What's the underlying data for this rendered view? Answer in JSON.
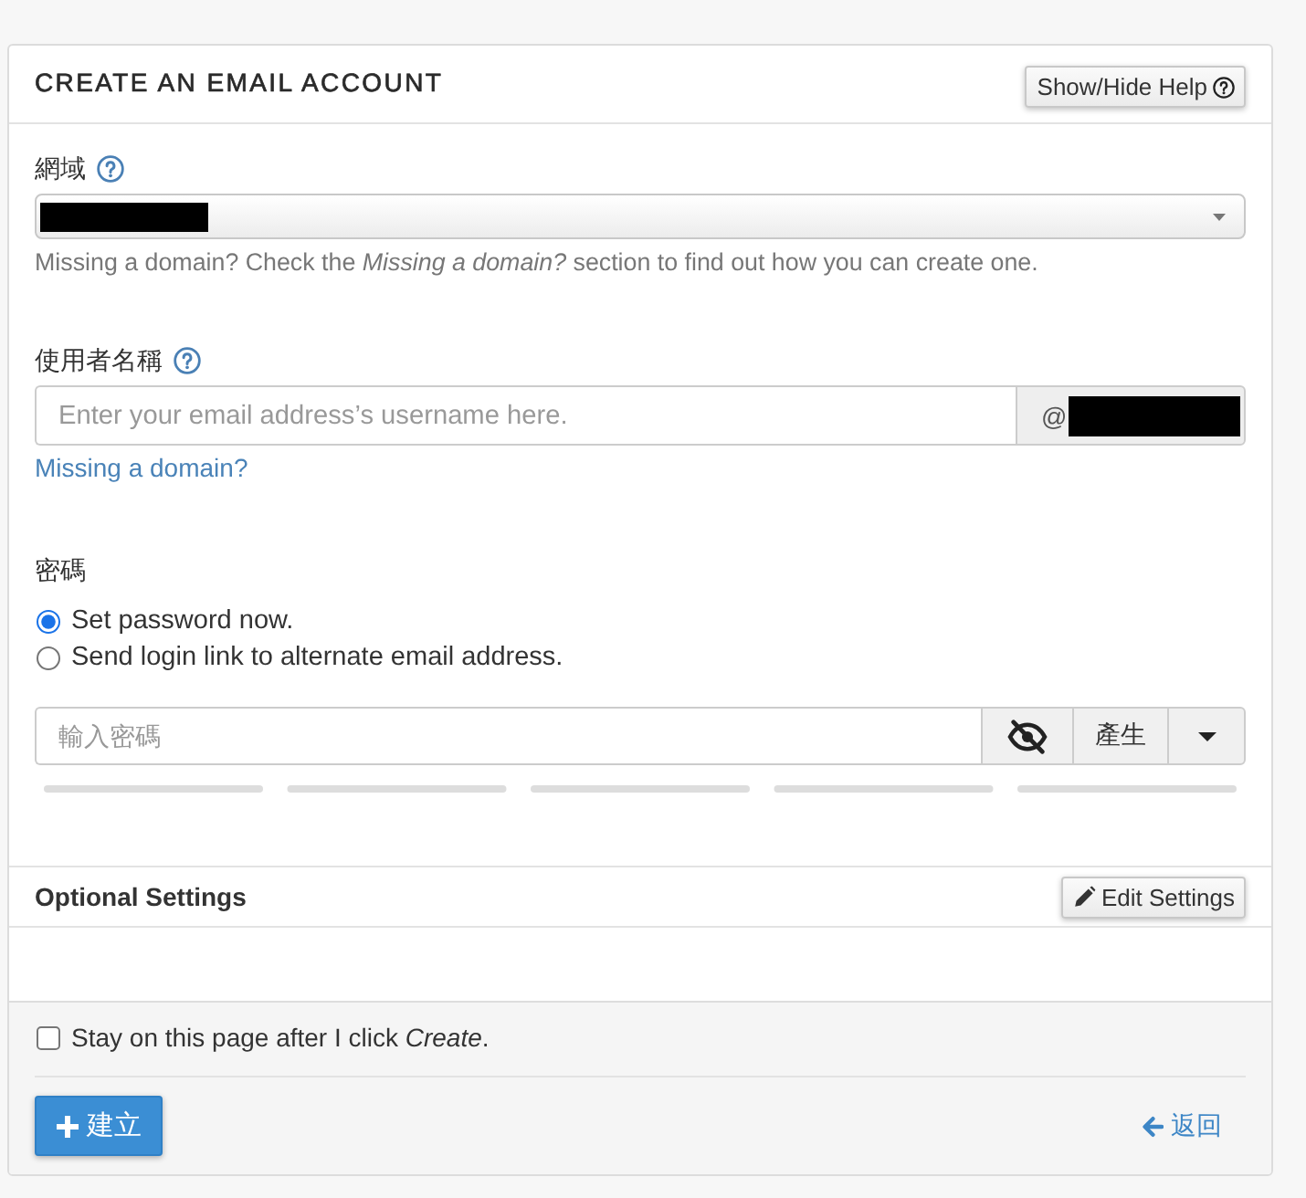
{
  "panel": {
    "title": "CREATE AN EMAIL ACCOUNT",
    "help_button": "Show/Hide Help"
  },
  "domain": {
    "label": "網域",
    "hint": "Missing a domain? Check the *Missing a domain?* section to find out how you can create one."
  },
  "username": {
    "label": "使用者名稱",
    "placeholder": "Enter your email address’s username here.",
    "suffix": "@",
    "link": "Missing a domain?"
  },
  "password": {
    "label": "密碼",
    "options": [
      {
        "label": "Set password now.",
        "selected": true
      },
      {
        "label": "Send login link to alternate email address.",
        "selected": false
      }
    ],
    "placeholder": "輸入密碼",
    "generate_button": "產生"
  },
  "optional_settings": {
    "title": "Optional Settings",
    "edit_button": "Edit Settings"
  },
  "footer": {
    "stay_option": {
      "label": "Stay on this page after I click *Create*.",
      "checked": false
    },
    "create_button": "建立",
    "back_link": "返回"
  }
}
